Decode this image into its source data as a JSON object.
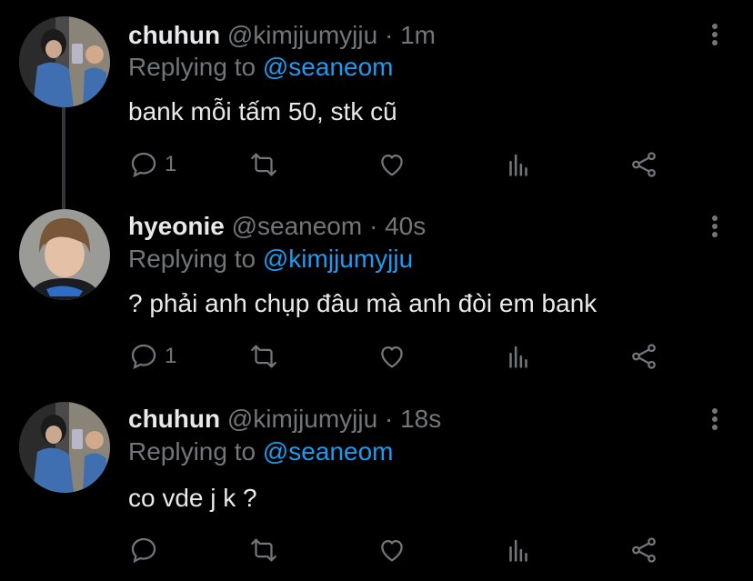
{
  "tweets": [
    {
      "name": "chuhun",
      "handle": "@kimjjumyjju",
      "separator": "·",
      "time": "1m",
      "replying_prefix": "Replying to",
      "replying_to": "@seaneom",
      "text": "bank mỗi tấm 50, stk cũ",
      "reply_count": "1",
      "avatar": "photo-person-holding-phone"
    },
    {
      "name": "hyeonie",
      "handle": "@seaneom",
      "separator": "·",
      "time": "40s",
      "replying_prefix": "Replying to",
      "replying_to": "@kimjjumyjju",
      "text": "? phải anh chụp đâu mà anh đòi em bank",
      "reply_count": "1",
      "avatar": "photo-person-portrait"
    },
    {
      "name": "chuhun",
      "handle": "@kimjjumyjju",
      "separator": "·",
      "time": "18s",
      "replying_prefix": "Replying to",
      "replying_to": "@seaneom",
      "text": "co vde j k ?",
      "reply_count": "",
      "avatar": "photo-person-holding-phone"
    }
  ],
  "icons": {
    "reply": "reply-icon",
    "retweet": "retweet-icon",
    "like": "heart-icon",
    "analytics": "analytics-icon",
    "share": "share-icon",
    "more": "more-options-icon"
  },
  "colors": {
    "background": "#000000",
    "text": "#e7e9ea",
    "secondary": "#71767b",
    "link": "#1d9bf0",
    "thread_line": "#333639"
  }
}
